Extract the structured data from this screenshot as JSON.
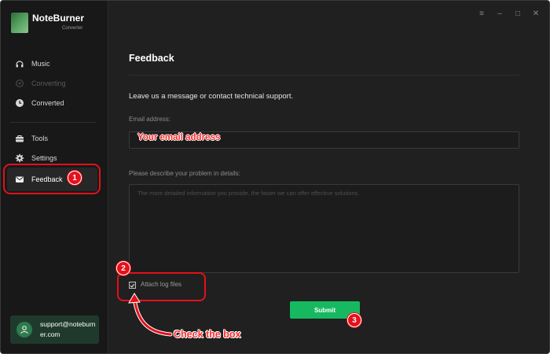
{
  "app": {
    "name": "NoteBurner",
    "subtitle": "Converter"
  },
  "sidebar": {
    "items": [
      {
        "label": "Music",
        "icon": "headphones-icon",
        "state": "normal"
      },
      {
        "label": "Converting",
        "icon": "converting-icon",
        "state": "disabled"
      },
      {
        "label": "Converted",
        "icon": "clock-icon",
        "state": "normal"
      },
      {
        "label": "Tools",
        "icon": "toolbox-icon",
        "state": "normal"
      },
      {
        "label": "Settings",
        "icon": "gear-icon",
        "state": "normal"
      },
      {
        "label": "Feedback",
        "icon": "mail-icon",
        "state": "active"
      }
    ],
    "user_email": "support@noteburner.com"
  },
  "window_controls": [
    "menu-icon",
    "minimize-icon",
    "maximize-icon",
    "close-icon"
  ],
  "feedback": {
    "title": "Feedback",
    "intro": "Leave us a message or contact technical support.",
    "email_label": "Email address:",
    "email_placeholder": "Your email address",
    "problem_label": "Please describe your problem in details:",
    "problem_placeholder": "The more detailed information you provide, the faster we can offer effective solutions.",
    "attach_label": "Attach log files",
    "attach_checked": true,
    "submit_label": "Submit"
  },
  "annotations": {
    "step1": "1",
    "step2": "2",
    "step3": "3",
    "callout": "Check the box"
  },
  "colors": {
    "accent": "#17b960",
    "annotation": "#e4111b",
    "sidebar_bg": "#181818",
    "main_bg": "#202020"
  }
}
